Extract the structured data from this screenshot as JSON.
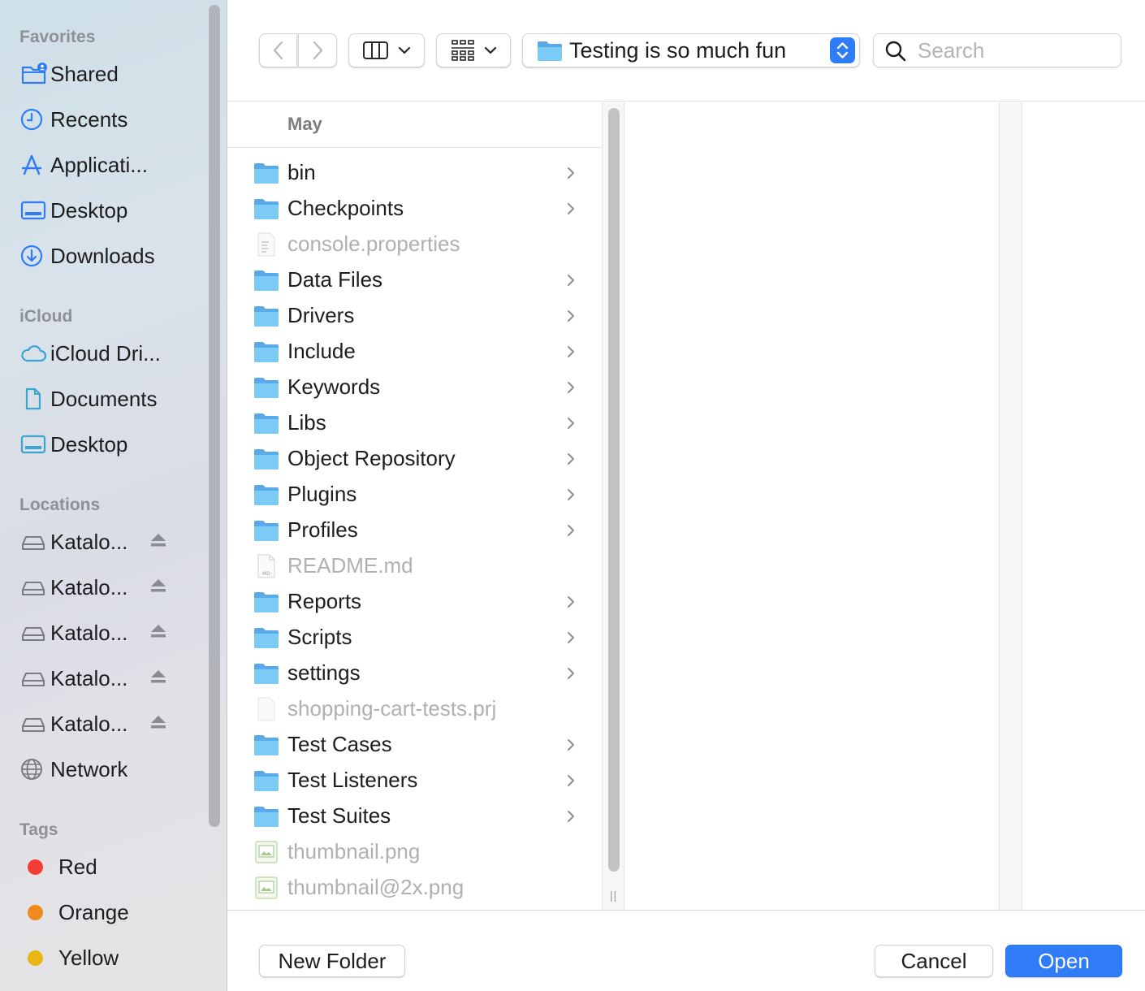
{
  "sidebar": {
    "sections": {
      "favorites": "Favorites",
      "icloud": "iCloud",
      "locations": "Locations",
      "tags": "Tags"
    },
    "favorites": [
      {
        "label": "Shared",
        "icon": "shared-folder-icon"
      },
      {
        "label": "Recents",
        "icon": "clock-icon"
      },
      {
        "label": "Applicati...",
        "icon": "applications-icon"
      },
      {
        "label": "Desktop",
        "icon": "desktop-icon"
      },
      {
        "label": "Downloads",
        "icon": "download-icon"
      }
    ],
    "icloud": [
      {
        "label": "iCloud Dri...",
        "icon": "cloud-icon"
      },
      {
        "label": "Documents",
        "icon": "document-icon"
      },
      {
        "label": "Desktop",
        "icon": "desktop-icon"
      }
    ],
    "locations": [
      {
        "label": "Katalo...",
        "icon": "drive-icon"
      },
      {
        "label": "Katalo...",
        "icon": "drive-icon"
      },
      {
        "label": "Katalo...",
        "icon": "drive-icon"
      },
      {
        "label": "Katalo...",
        "icon": "drive-icon"
      },
      {
        "label": "Katalo...",
        "icon": "drive-icon"
      },
      {
        "label": "Network",
        "icon": "globe-icon"
      }
    ],
    "tags": [
      {
        "label": "Red",
        "color": "#f23c35"
      },
      {
        "label": "Orange",
        "color": "#f08a1c"
      },
      {
        "label": "Yellow",
        "color": "#e9b613"
      }
    ]
  },
  "toolbar": {
    "path_label": "Testing is so much fun",
    "search_placeholder": "Search"
  },
  "browser": {
    "column_header": "May",
    "items": [
      {
        "name": "bin",
        "type": "folder",
        "enabled": true
      },
      {
        "name": "Checkpoints",
        "type": "folder",
        "enabled": true
      },
      {
        "name": "console.properties",
        "type": "text-file",
        "enabled": false
      },
      {
        "name": "Data Files",
        "type": "folder",
        "enabled": true
      },
      {
        "name": "Drivers",
        "type": "folder",
        "enabled": true
      },
      {
        "name": "Include",
        "type": "folder",
        "enabled": true
      },
      {
        "name": "Keywords",
        "type": "folder",
        "enabled": true
      },
      {
        "name": "Libs",
        "type": "folder",
        "enabled": true
      },
      {
        "name": "Object Repository",
        "type": "folder",
        "enabled": true
      },
      {
        "name": "Plugins",
        "type": "folder",
        "enabled": true
      },
      {
        "name": "Profiles",
        "type": "folder",
        "enabled": true
      },
      {
        "name": "README.md",
        "type": "md-file",
        "enabled": false
      },
      {
        "name": "Reports",
        "type": "folder",
        "enabled": true
      },
      {
        "name": "Scripts",
        "type": "folder",
        "enabled": true
      },
      {
        "name": "settings",
        "type": "folder",
        "enabled": true
      },
      {
        "name": "shopping-cart-tests.prj",
        "type": "blank-file",
        "enabled": false
      },
      {
        "name": "Test Cases",
        "type": "folder",
        "enabled": true
      },
      {
        "name": "Test Listeners",
        "type": "folder",
        "enabled": true
      },
      {
        "name": "Test Suites",
        "type": "folder",
        "enabled": true
      },
      {
        "name": "thumbnail.png",
        "type": "image-file",
        "enabled": false
      },
      {
        "name": "thumbnail@2x.png",
        "type": "image-file",
        "enabled": false
      }
    ]
  },
  "footer": {
    "new_folder_label": "New Folder",
    "cancel_label": "Cancel",
    "open_label": "Open"
  },
  "colors": {
    "accent": "#2f7cf6",
    "sidebar_icon": "#2f7cf6",
    "icloud_icon": "#3aa6d0",
    "folder": "#6fbff5"
  }
}
